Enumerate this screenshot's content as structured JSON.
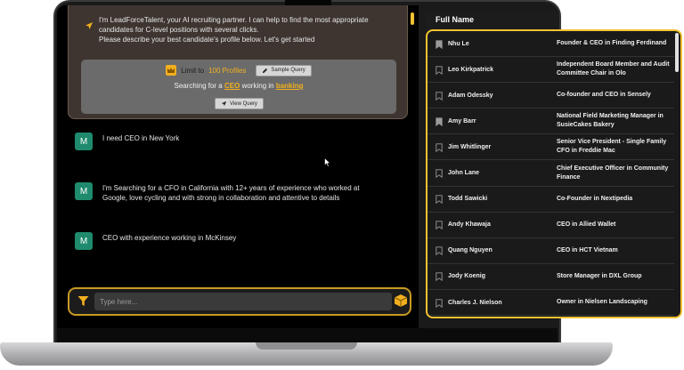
{
  "chat": {
    "intro_text": "I'm LeadForceTalent, your AI recruiting partner. I can help to find the most appropriate candidates for C-level positions with several clicks.\nPlease describe your best candidate's profile below. Let's get started",
    "limit_prefix": "Limit to",
    "limit_value": "100 Profiles",
    "sample_query_label": "Sample Query",
    "search_prefix": "Searching for a",
    "search_role": "CEO",
    "search_middle": "working in",
    "search_industry": "banking",
    "view_query_label": "View Query",
    "avatar_letter": "M",
    "messages": [
      "I need CEO in New York",
      "I'm Searching for a CFO in California with 12+ years of experience who worked at Google, love cycling and with strong in collaboration and attentive to details",
      "CEO with experience working in McKinsey"
    ],
    "input_placeholder": "Type here..."
  },
  "results": {
    "column_header": "Full Name",
    "rows": [
      {
        "name": "Nhu Le",
        "title": "Founder & CEO in Finding Ferdinand",
        "saved": true
      },
      {
        "name": "Leo Kirkpatrick",
        "title": "Independent Board Member and Audit Committee Chair in Olo",
        "saved": false
      },
      {
        "name": "Adam Odessky",
        "title": "Co-founder and CEO in Sensely",
        "saved": false
      },
      {
        "name": "Amy Barr",
        "title": "National Field Marketing Manager in SusieCakes Bakery",
        "saved": true
      },
      {
        "name": "Jim Whitlinger",
        "title": "Senior Vice President - Single Family CFO in Freddie Mac",
        "saved": false
      },
      {
        "name": "John Lane",
        "title": "Chief Executive Officer in Community Finance",
        "saved": false
      },
      {
        "name": "Todd Sawicki",
        "title": "Co-Founder in Nextipedia",
        "saved": false
      },
      {
        "name": "Andy Khawaja",
        "title": "CEO in Allied Wallet",
        "saved": false
      },
      {
        "name": "Quang Nguyen",
        "title": "CEO in HCT Vietnam",
        "saved": false
      },
      {
        "name": "Jody Koenig",
        "title": "Store Manager in DXL Group",
        "saved": false
      },
      {
        "name": "Charles J. Nielson",
        "title": "Owner in Nielsen Landscaping",
        "saved": false
      }
    ]
  },
  "colors": {
    "accent": "#f2c230",
    "avatar": "#1f8a6d"
  }
}
